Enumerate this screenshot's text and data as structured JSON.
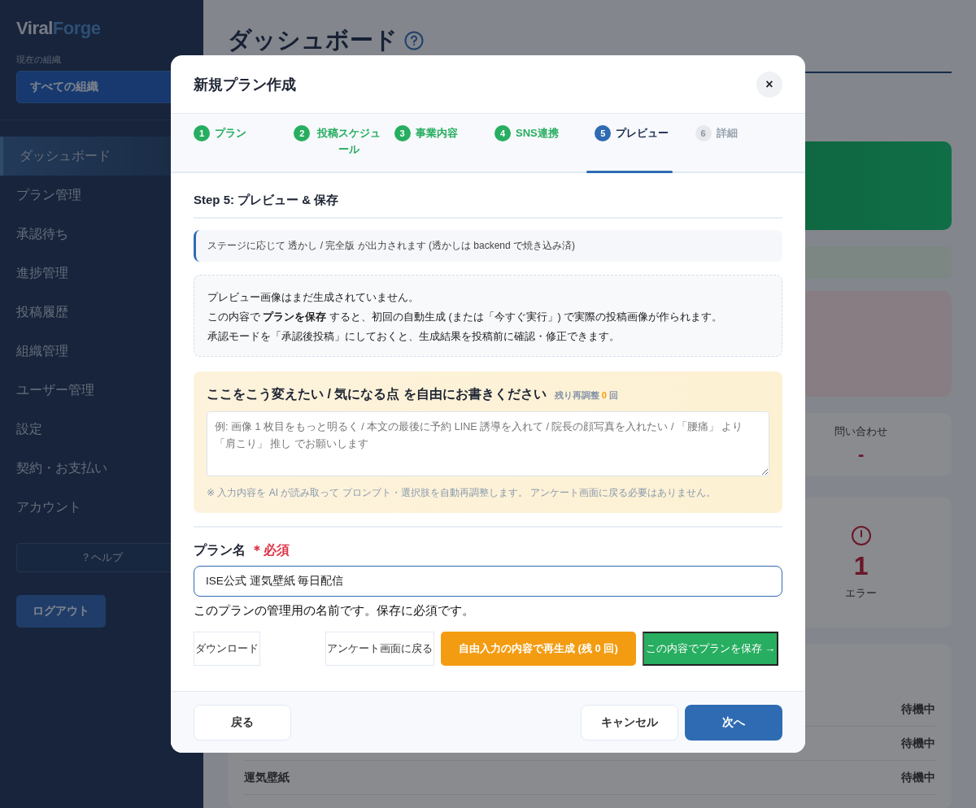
{
  "sidebar": {
    "logo": [
      "Viral",
      "Forge"
    ],
    "org_label": "現在の組織",
    "org_select": "すべての組織",
    "items": [
      {
        "label": "ダッシュボード",
        "selected": true
      },
      {
        "label": "プラン管理",
        "selected": false
      },
      {
        "label": "承認待ち",
        "selected": false
      },
      {
        "label": "進捗管理",
        "selected": false
      },
      {
        "label": "投稿履歴",
        "selected": false
      },
      {
        "label": "組織管理",
        "selected": false
      },
      {
        "label": "ユーザー管理",
        "selected": false
      },
      {
        "label": "設定",
        "selected": false
      },
      {
        "label": "契約・お支払い",
        "selected": false
      },
      {
        "label": "アカウント",
        "selected": false
      }
    ],
    "help_button": "？ヘルプ",
    "logout_button": "ログアウト"
  },
  "dashboard": {
    "title": "ダッシュボード",
    "stat": {
      "label": "問い合わせ",
      "value": "-"
    },
    "error_stat": {
      "value": "1",
      "label": "エラー"
    },
    "rows": [
      {
        "name": "",
        "status": "待機中"
      },
      {
        "name": "",
        "status": "待機中"
      },
      {
        "name": "運気壁紙",
        "status": "待機中"
      }
    ]
  },
  "modal": {
    "title": "新規プラン作成",
    "close": "×",
    "steps": [
      {
        "number": "1",
        "label": "プラン",
        "completed": true,
        "selected": false
      },
      {
        "number": "2",
        "label": "投稿スケジュール",
        "completed": true,
        "selected": false
      },
      {
        "number": "3",
        "label": "事業内容",
        "completed": true,
        "selected": false
      },
      {
        "number": "4",
        "label": "SNS連携",
        "completed": true,
        "selected": false
      },
      {
        "number": "5",
        "label": "プレビュー",
        "completed": false,
        "selected": true
      },
      {
        "number": "6",
        "label": "詳細",
        "completed": false,
        "selected": false
      }
    ],
    "section_title": "Step 5: プレビュー & 保存",
    "info": "ステージに応じて 透かし / 完全版 が出力されます (透かしは backend で焼き込み済)",
    "preview_notice": [
      "プレビュー画像はまだ生成されていません。",
      "この内容で **プランを保存** すると、初回の自動生成 (または「今すぐ実行」) で実際の投稿画像が作られます。",
      "承認モードを「承認後投稿」にしておくと、生成結果を投稿前に確認・修正できます。"
    ],
    "feedback": {
      "title": "ここをこう変えたい / 気になる点 を自由にお書きください",
      "remaining": "残り再調整 **0** 回",
      "placeholder": "例: 画像 1 枚目をもっと明るく / 本文の最後に予約 LINE 誘導を入れて / 院長の顔写真を入れたい / 「腰痛」 より「肩こり」 推し でお願いします",
      "note": "※ 入力内容を AI が読み取って プロンプト・選択肢を自動再調整します。 アンケート画面に戻る必要はありません。"
    },
    "plan_name": {
      "label": "プラン名",
      "required": "＊必須",
      "value": "ISE公式 運気壁紙 毎日配信",
      "help": "このプランの管理用の名前です。保存に必須です。"
    },
    "actions": [
      {
        "label": "ダウンロード",
        "kind": "plain"
      },
      {
        "label": "アンケート画面に戻る",
        "kind": "plain"
      },
      {
        "label": "自由入力の内容で再生成 (残 0 回)",
        "kind": "warning"
      },
      {
        "label": "この内容でプランを保存 →",
        "kind": "success"
      }
    ],
    "footer": {
      "back": "戻る",
      "cancel": "キャンセル",
      "next": "次へ"
    }
  }
}
